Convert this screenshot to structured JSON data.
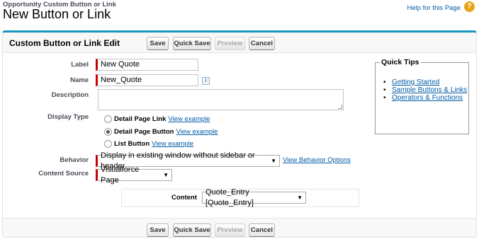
{
  "header": {
    "breadcrumb": "Opportunity Custom Button or Link",
    "title": "New Button or Link",
    "help_link": "Help for this Page",
    "help_icon": "?"
  },
  "panel": {
    "title": "Custom Button or Link Edit"
  },
  "buttons": {
    "save": "Save",
    "quick_save": "Quick Save",
    "preview": "Preview",
    "cancel": "Cancel"
  },
  "form": {
    "label": {
      "label": "Label",
      "value": "New Quote"
    },
    "name": {
      "label": "Name",
      "value": "New_Quote",
      "info_icon": "i"
    },
    "description": {
      "label": "Description",
      "value": ""
    },
    "display_type": {
      "label": "Display Type",
      "options": [
        {
          "label": "Detail Page Link",
          "link": "View example",
          "checked": false
        },
        {
          "label": "Detail Page Button",
          "link": "View example",
          "checked": true
        },
        {
          "label": "List Button",
          "link": "View example",
          "checked": false
        }
      ]
    },
    "behavior": {
      "label": "Behavior",
      "value": "Display in existing window without sidebar or header",
      "options_link": "View Behavior Options"
    },
    "content_source": {
      "label": "Content Source",
      "value": "Visualforce Page"
    },
    "content": {
      "label": "Content",
      "value": "Quote_Entry [Quote_Entry]"
    }
  },
  "quick_tips": {
    "title": "Quick Tips",
    "items": [
      "Getting Started",
      "Sample Buttons & Links",
      "Operators & Functions"
    ]
  },
  "icons": {
    "help": "help-icon",
    "info": "info-icon",
    "dropdown": "chevron-down-icon"
  },
  "colors": {
    "accent": "#1797c0",
    "required": "#cc0000",
    "link": "#015ba7",
    "help_icon": "#e8a317"
  }
}
